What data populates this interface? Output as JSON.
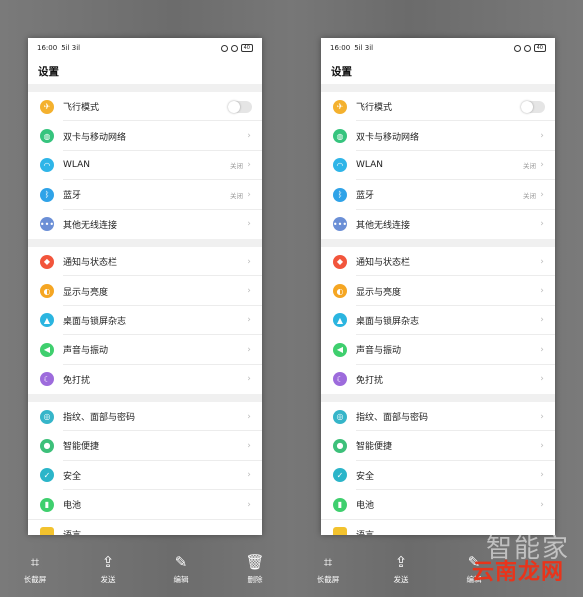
{
  "screens": [
    {
      "status": {
        "time": "16:00",
        "signal": "5il 3il",
        "battery": "40"
      },
      "title": "设置",
      "groups": [
        [
          {
            "label": "飞行模式",
            "icon": "airplane-icon",
            "color": "#f4b12e",
            "type": "toggle"
          },
          {
            "label": "双卡与移动网络",
            "icon": "globe-icon",
            "color": "#36c47e",
            "type": "chev"
          },
          {
            "label": "WLAN",
            "icon": "wifi-icon",
            "color": "#2fb5e8",
            "type": "chev",
            "value": "关闭"
          },
          {
            "label": "蓝牙",
            "icon": "bluetooth-icon",
            "color": "#2fa3e8",
            "type": "chev",
            "value": "关闭"
          },
          {
            "label": "其他无线连接",
            "icon": "more-icon",
            "color": "#6b8fd6",
            "type": "chev"
          }
        ],
        [
          {
            "label": "通知与状态栏",
            "icon": "bell-icon",
            "color": "#f2553c",
            "type": "chev"
          },
          {
            "label": "显示与亮度",
            "icon": "brightness-icon",
            "color": "#f5a623",
            "type": "chev"
          },
          {
            "label": "桌面与锁屏杂志",
            "icon": "wallpaper-icon",
            "color": "#2bb5e0",
            "type": "chev"
          },
          {
            "label": "声音与振动",
            "icon": "speaker-icon",
            "color": "#3fcf6e",
            "type": "chev"
          },
          {
            "label": "免打扰",
            "icon": "moon-icon",
            "color": "#9d6bdc",
            "type": "chev"
          }
        ],
        [
          {
            "label": "指纹、面部与密码",
            "icon": "fingerprint-icon",
            "color": "#36b5c9",
            "type": "chev"
          },
          {
            "label": "智能便捷",
            "icon": "smart-icon",
            "color": "#3dc07a",
            "type": "chev"
          },
          {
            "label": "安全",
            "icon": "shield-icon",
            "color": "#2bb5c9",
            "type": "chev"
          },
          {
            "label": "电池",
            "icon": "battery-icon",
            "color": "#3fcf6e",
            "type": "chev"
          }
        ]
      ],
      "cut_label": "语言"
    }
  ],
  "toolbar": [
    {
      "label": "长截屏",
      "icon": "crop-icon"
    },
    {
      "label": "发送",
      "icon": "share-icon"
    },
    {
      "label": "编辑",
      "icon": "pen-icon"
    },
    {
      "label": "删除",
      "icon": "trash-icon"
    },
    {
      "label": "长截屏",
      "icon": "crop-icon"
    },
    {
      "label": "发送",
      "icon": "share-icon"
    },
    {
      "label": "编辑",
      "icon": "pen-icon"
    }
  ],
  "watermark": {
    "top": "智能家",
    "bottom": "云南龙网"
  }
}
